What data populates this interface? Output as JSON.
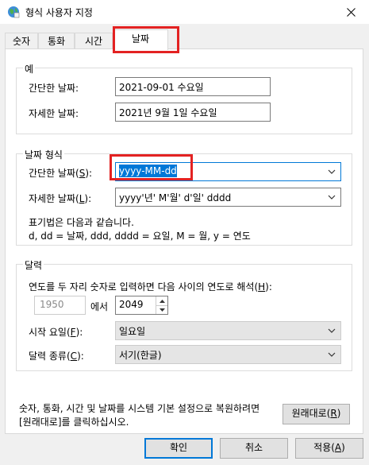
{
  "window": {
    "title": "형식 사용자 지정",
    "close_icon": "close-icon"
  },
  "tabs": [
    "숫자",
    "통화",
    "시간",
    "날짜"
  ],
  "active_tab": "날짜",
  "example": {
    "legend": "예",
    "short_label": "간단한 날짜:",
    "short_value": "2021-09-01 수요일",
    "long_label": "자세한 날짜:",
    "long_value": "2021년 9월 1일 수요일"
  },
  "format": {
    "legend": "날짜 형식",
    "short_label_pre": "간단한 날짜(",
    "short_label_key": "S",
    "short_label_post": "):",
    "short_value": "yyyy-MM-dd",
    "long_label_pre": "자세한 날짜(",
    "long_label_key": "L",
    "long_label_post": "):",
    "long_value": "yyyy'년' M'월' d'일' dddd",
    "notation_line1": "표기법은 다음과 같습니다.",
    "notation_line2": "d, dd = 날짜,  ddd, dddd = 요일,  M = 월,  y = 연도"
  },
  "calendar": {
    "legend": "달력",
    "twodigit_pre": "연도를 두 자리 숫자로 입력하면 다음 사이의 연도로 해석(",
    "twodigit_key": "H",
    "twodigit_post": "):",
    "year_from": "1950",
    "between": "에서",
    "year_to": "2049",
    "first_day_pre": "시작 요일(",
    "first_day_key": "F",
    "first_day_post": "):",
    "first_day_value": "일요일",
    "cal_type_pre": "달력 종류(",
    "cal_type_key": "C",
    "cal_type_post": "):",
    "cal_type_value": "서기(한글)"
  },
  "reset": {
    "text_line1": "숫자, 통화, 시간 및 날짜를 시스템 기본 설정으로 복원하려면",
    "text_line2": "[원래대로]를 클릭하십시오.",
    "button_pre": "원래대로(",
    "button_key": "R",
    "button_post": ")"
  },
  "footer": {
    "ok": "확인",
    "cancel": "취소",
    "apply_pre": "적용(",
    "apply_key": "A",
    "apply_post": ")"
  },
  "colors": {
    "highlight": "#e32222",
    "selection": "#0078d7"
  }
}
